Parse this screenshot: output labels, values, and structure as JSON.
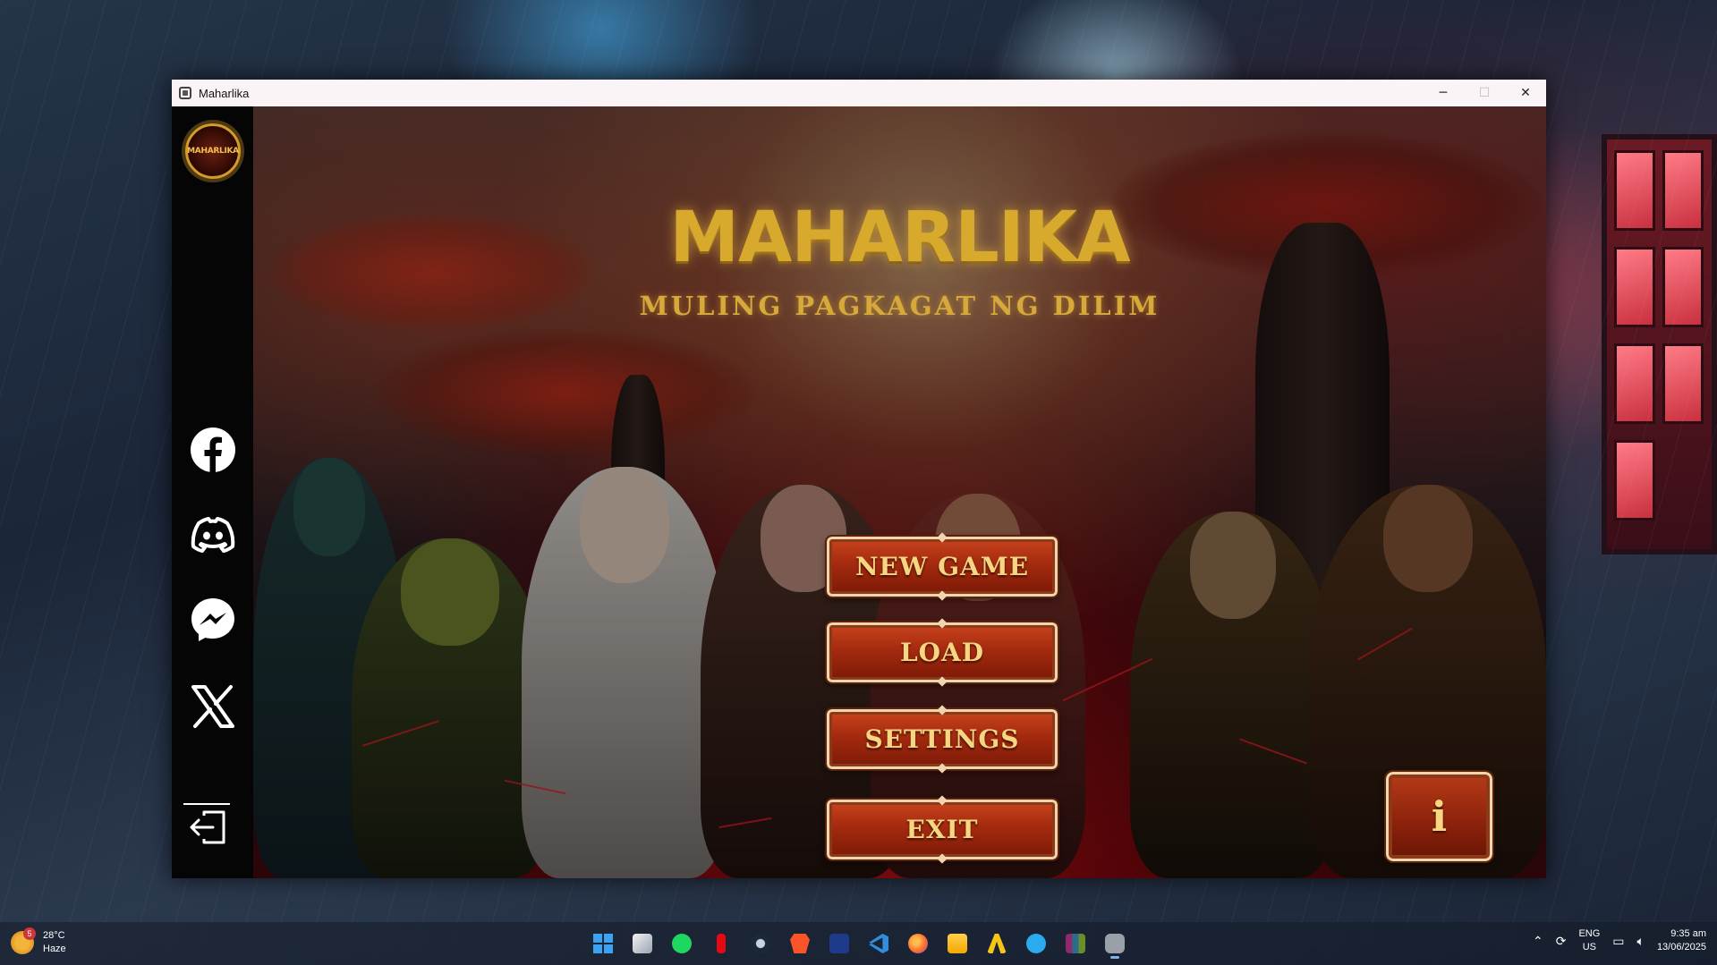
{
  "window": {
    "title": "Maharlika",
    "minimize": "─",
    "maximize": "☐",
    "close": "✕"
  },
  "sidebar": {
    "logo_text": "MAHARLIKA",
    "socials": [
      "facebook",
      "discord",
      "messenger",
      "x"
    ]
  },
  "game": {
    "title": "MAHARLIKA",
    "subtitle": "MULING PAGKAGAT NG DILIM",
    "menu": {
      "new_game": "NEW GAME",
      "load": "LOAD",
      "settings": "SETTINGS",
      "exit": "EXIT"
    },
    "info_label": "i"
  },
  "taskbar": {
    "weather": {
      "badge": "5",
      "temp": "28°C",
      "condition": "Haze"
    },
    "apps": [
      "windows-start",
      "file-explorer-task",
      "spotify",
      "netflix",
      "steam",
      "brave",
      "app-store",
      "vscode",
      "firefox",
      "folder",
      "app-gold",
      "telegram",
      "winrar",
      "maharlika-app"
    ],
    "language_line1": "ENG",
    "language_line2": "US",
    "time": "9:35 am",
    "date": "13/06/2025"
  }
}
